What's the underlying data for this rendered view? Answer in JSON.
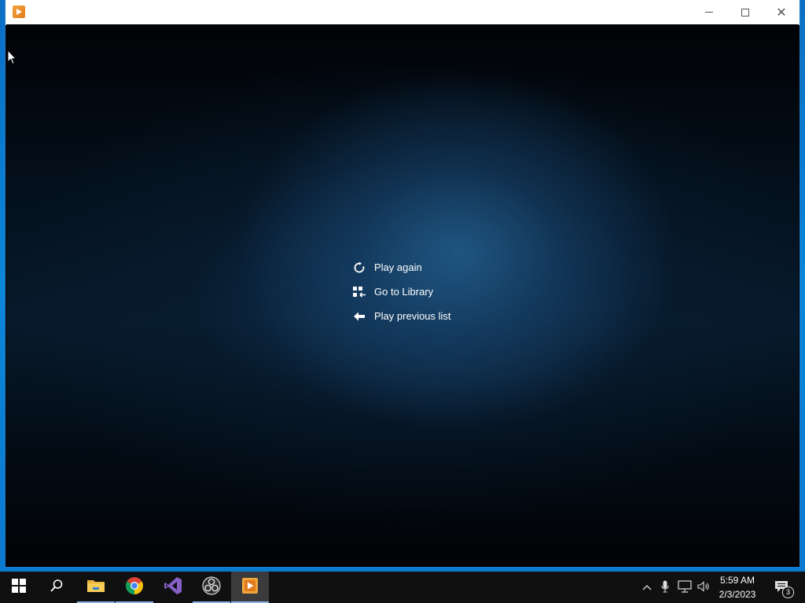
{
  "window": {
    "title": "",
    "minimize_icon": "minimize-icon",
    "maximize_icon": "maximize-icon",
    "close_icon": "close-icon"
  },
  "player": {
    "menu": [
      {
        "label": "Play again",
        "icon": "replay-icon"
      },
      {
        "label": "Go to Library",
        "icon": "library-icon"
      },
      {
        "label": "Play previous list",
        "icon": "back-arrow-icon"
      }
    ]
  },
  "taskbar": {
    "apps": [
      {
        "name": "start",
        "icon": "windows-start-icon"
      },
      {
        "name": "search",
        "icon": "search-icon"
      },
      {
        "name": "file-explorer",
        "icon": "folder-icon"
      },
      {
        "name": "chrome",
        "icon": "chrome-icon"
      },
      {
        "name": "visual-studio",
        "icon": "visual-studio-icon"
      },
      {
        "name": "obs",
        "icon": "obs-icon"
      },
      {
        "name": "media-player",
        "icon": "media-player-icon"
      }
    ],
    "tray": {
      "time": "5:59 AM",
      "date": "2/3/2023",
      "notification_count": "3"
    }
  },
  "colors": {
    "desktop": "#0a7fd4",
    "taskbar": "#101010",
    "accent": "#1a7ed0"
  }
}
